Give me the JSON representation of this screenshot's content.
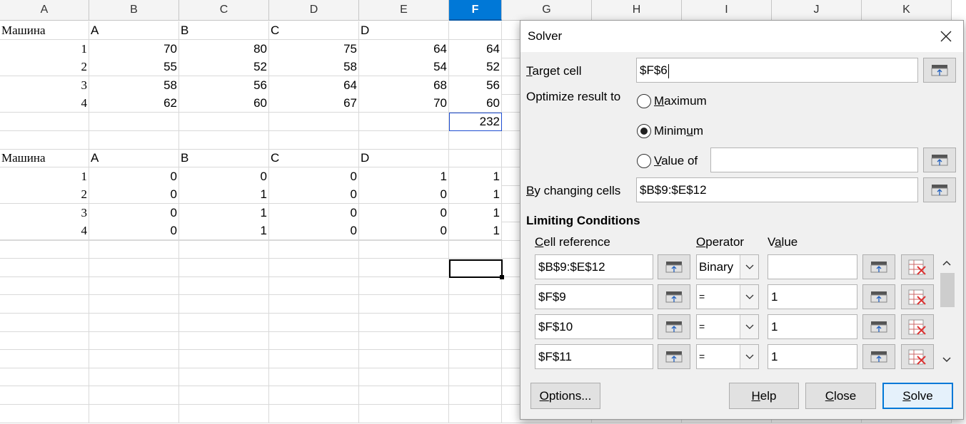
{
  "sheet": {
    "columns": [
      "A",
      "B",
      "C",
      "D",
      "E",
      "F",
      "G",
      "H",
      "I",
      "J",
      "K"
    ],
    "active_column": "F",
    "table1": {
      "header": [
        "Машина",
        "A",
        "B",
        "C",
        "D"
      ],
      "rows": [
        [
          "1",
          "70",
          "80",
          "75",
          "64",
          "64"
        ],
        [
          "2",
          "55",
          "52",
          "58",
          "54",
          "52"
        ],
        [
          "3",
          "58",
          "56",
          "64",
          "68",
          "56"
        ],
        [
          "4",
          "62",
          "60",
          "67",
          "70",
          "60"
        ]
      ],
      "total": "232"
    },
    "table2": {
      "header": [
        "Машина",
        "A",
        "B",
        "C",
        "D"
      ],
      "rows": [
        [
          "1",
          "0",
          "0",
          "0",
          "1",
          "1"
        ],
        [
          "2",
          "0",
          "1",
          "0",
          "0",
          "1"
        ],
        [
          "3",
          "0",
          "1",
          "0",
          "0",
          "1"
        ],
        [
          "4",
          "0",
          "1",
          "0",
          "0",
          "1"
        ]
      ]
    }
  },
  "solver": {
    "title": "Solver",
    "target_cell_label": "Target cell",
    "target_cell_value": "$F$6",
    "optimize_label": "Optimize result to",
    "options": {
      "maximum": "Maximum",
      "minimum": "Minimum",
      "value_of": "Value of"
    },
    "selected_option": "minimum",
    "value_of_input": "",
    "changing_cells_label": "By changing cells",
    "changing_cells_value": "$B$9:$E$12",
    "limiting_conditions_title": "Limiting Conditions",
    "conditions_headers": {
      "cell_reference": "Cell reference",
      "operator": "Operator",
      "value": "Value"
    },
    "conditions": [
      {
        "cell_reference": "$B$9:$E$12",
        "operator": "Binary",
        "value": ""
      },
      {
        "cell_reference": "$F$9",
        "operator": "=",
        "value": "1"
      },
      {
        "cell_reference": "$F$10",
        "operator": "=",
        "value": "1"
      },
      {
        "cell_reference": "$F$11",
        "operator": "=",
        "value": "1"
      }
    ],
    "buttons": {
      "options": "Options...",
      "help": "Help",
      "close": "Close",
      "solve": "Solve"
    },
    "colors": {
      "default_button_border": "#0078d7",
      "active_column_header": "#0078d7"
    }
  }
}
